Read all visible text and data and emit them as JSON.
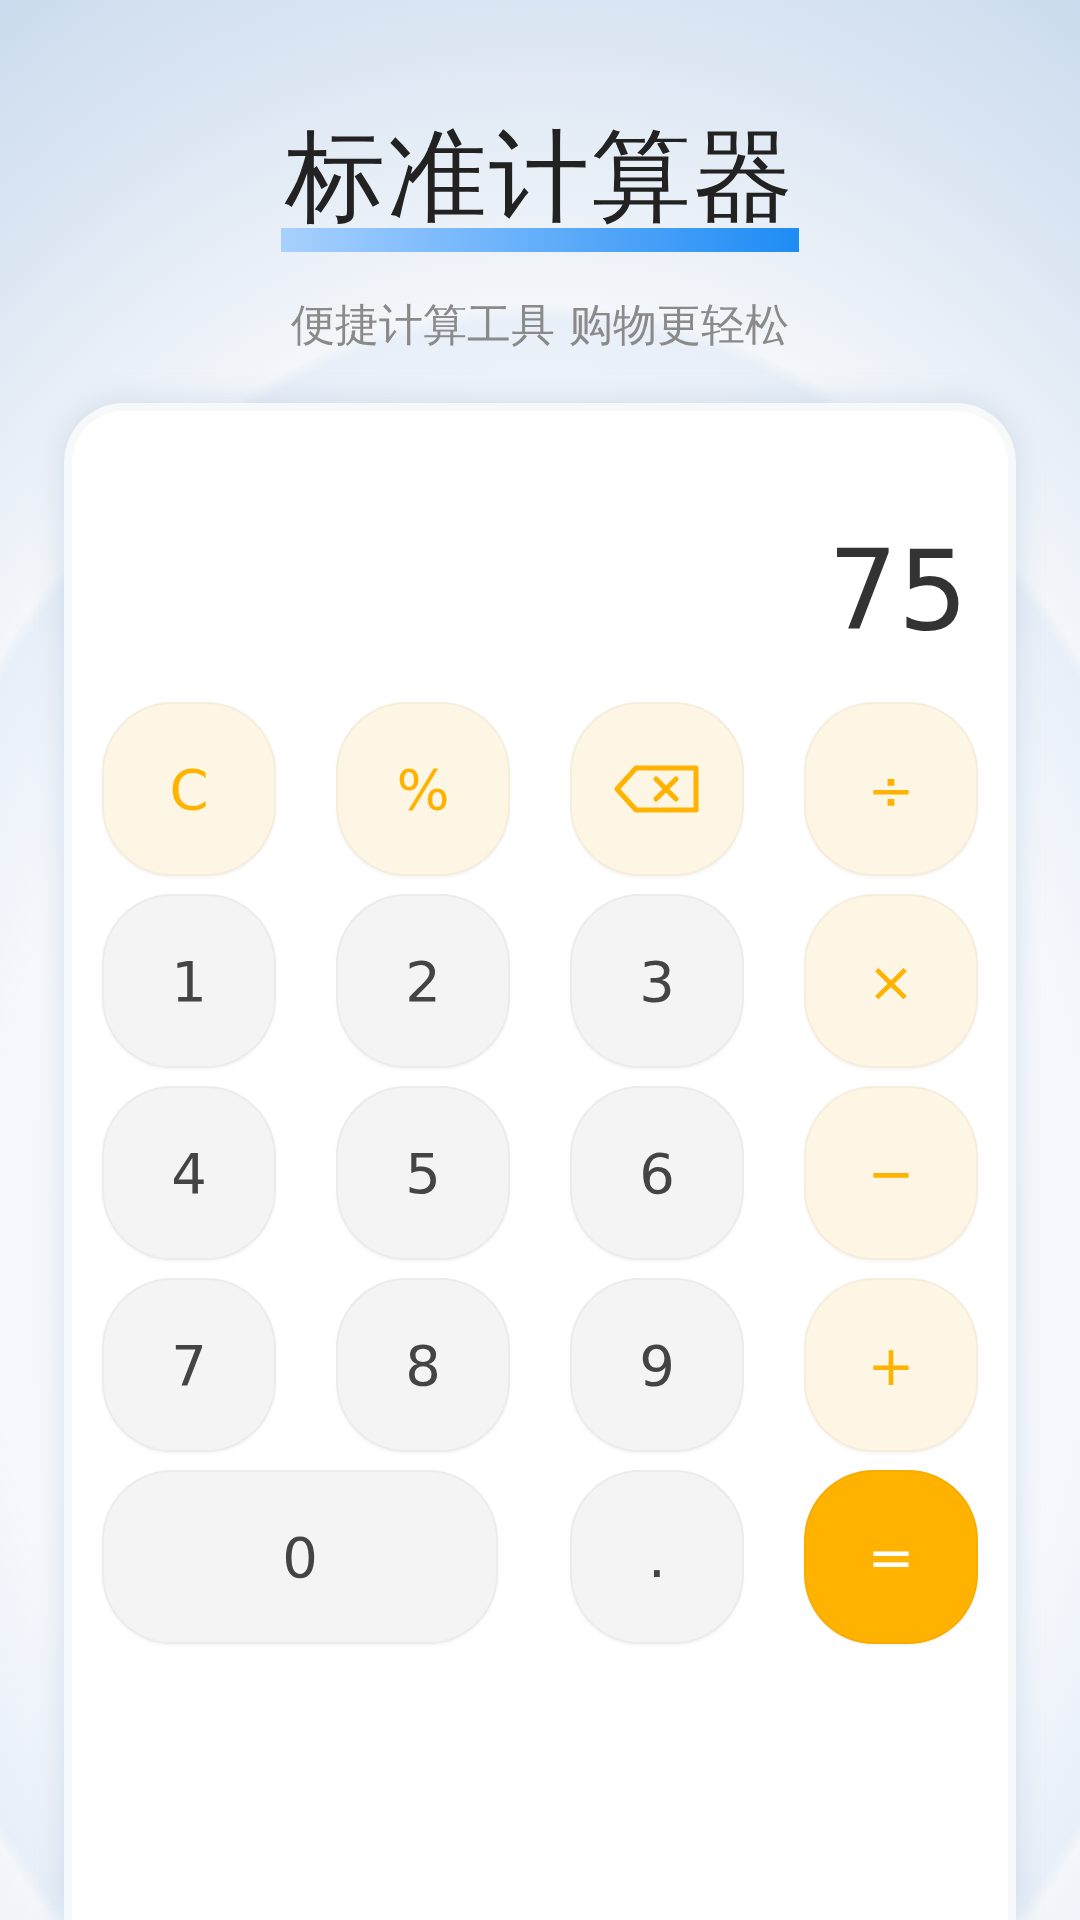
{
  "header": {
    "title": "标准计算器",
    "subtitle": "便捷计算工具 购物更轻松"
  },
  "display": {
    "value": "75"
  },
  "keys": [
    {
      "kind": "func",
      "label": "C",
      "wide": false
    },
    {
      "kind": "func",
      "label": "%",
      "wide": false
    },
    {
      "kind": "backspace",
      "wide": false
    },
    {
      "kind": "op",
      "label": "÷",
      "wide": false
    },
    {
      "kind": "digit",
      "label": "1",
      "wide": false
    },
    {
      "kind": "digit",
      "label": "2",
      "wide": false
    },
    {
      "kind": "digit",
      "label": "3",
      "wide": false
    },
    {
      "kind": "op",
      "label": "×",
      "wide": false
    },
    {
      "kind": "digit",
      "label": "4",
      "wide": false
    },
    {
      "kind": "digit",
      "label": "5",
      "wide": false
    },
    {
      "kind": "digit",
      "label": "6",
      "wide": false
    },
    {
      "kind": "op",
      "label": "−",
      "wide": false
    },
    {
      "kind": "digit",
      "label": "7",
      "wide": false
    },
    {
      "kind": "digit",
      "label": "8",
      "wide": false
    },
    {
      "kind": "digit",
      "label": "9",
      "wide": false
    },
    {
      "kind": "op",
      "label": "+",
      "wide": false
    },
    {
      "kind": "digit",
      "label": "0",
      "wide": true
    },
    {
      "kind": "digit",
      "label": ".",
      "wide": false
    },
    {
      "kind": "equals",
      "label": "=",
      "wide": false
    }
  ]
}
